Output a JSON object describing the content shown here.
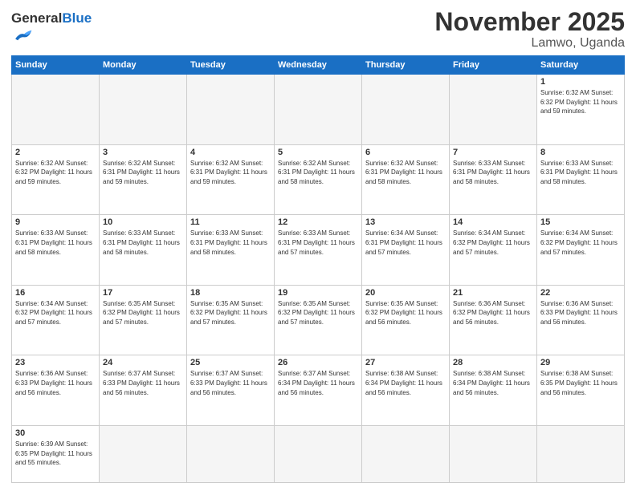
{
  "header": {
    "logo_general": "General",
    "logo_blue": "Blue",
    "month": "November 2025",
    "location": "Lamwo, Uganda"
  },
  "weekdays": [
    "Sunday",
    "Monday",
    "Tuesday",
    "Wednesday",
    "Thursday",
    "Friday",
    "Saturday"
  ],
  "weeks": [
    [
      {
        "day": "",
        "info": ""
      },
      {
        "day": "",
        "info": ""
      },
      {
        "day": "",
        "info": ""
      },
      {
        "day": "",
        "info": ""
      },
      {
        "day": "",
        "info": ""
      },
      {
        "day": "",
        "info": ""
      },
      {
        "day": "1",
        "info": "Sunrise: 6:32 AM\nSunset: 6:32 PM\nDaylight: 11 hours\nand 59 minutes."
      }
    ],
    [
      {
        "day": "2",
        "info": "Sunrise: 6:32 AM\nSunset: 6:32 PM\nDaylight: 11 hours\nand 59 minutes."
      },
      {
        "day": "3",
        "info": "Sunrise: 6:32 AM\nSunset: 6:31 PM\nDaylight: 11 hours\nand 59 minutes."
      },
      {
        "day": "4",
        "info": "Sunrise: 6:32 AM\nSunset: 6:31 PM\nDaylight: 11 hours\nand 59 minutes."
      },
      {
        "day": "5",
        "info": "Sunrise: 6:32 AM\nSunset: 6:31 PM\nDaylight: 11 hours\nand 58 minutes."
      },
      {
        "day": "6",
        "info": "Sunrise: 6:32 AM\nSunset: 6:31 PM\nDaylight: 11 hours\nand 58 minutes."
      },
      {
        "day": "7",
        "info": "Sunrise: 6:33 AM\nSunset: 6:31 PM\nDaylight: 11 hours\nand 58 minutes."
      },
      {
        "day": "8",
        "info": "Sunrise: 6:33 AM\nSunset: 6:31 PM\nDaylight: 11 hours\nand 58 minutes."
      }
    ],
    [
      {
        "day": "9",
        "info": "Sunrise: 6:33 AM\nSunset: 6:31 PM\nDaylight: 11 hours\nand 58 minutes."
      },
      {
        "day": "10",
        "info": "Sunrise: 6:33 AM\nSunset: 6:31 PM\nDaylight: 11 hours\nand 58 minutes."
      },
      {
        "day": "11",
        "info": "Sunrise: 6:33 AM\nSunset: 6:31 PM\nDaylight: 11 hours\nand 58 minutes."
      },
      {
        "day": "12",
        "info": "Sunrise: 6:33 AM\nSunset: 6:31 PM\nDaylight: 11 hours\nand 57 minutes."
      },
      {
        "day": "13",
        "info": "Sunrise: 6:34 AM\nSunset: 6:31 PM\nDaylight: 11 hours\nand 57 minutes."
      },
      {
        "day": "14",
        "info": "Sunrise: 6:34 AM\nSunset: 6:32 PM\nDaylight: 11 hours\nand 57 minutes."
      },
      {
        "day": "15",
        "info": "Sunrise: 6:34 AM\nSunset: 6:32 PM\nDaylight: 11 hours\nand 57 minutes."
      }
    ],
    [
      {
        "day": "16",
        "info": "Sunrise: 6:34 AM\nSunset: 6:32 PM\nDaylight: 11 hours\nand 57 minutes."
      },
      {
        "day": "17",
        "info": "Sunrise: 6:35 AM\nSunset: 6:32 PM\nDaylight: 11 hours\nand 57 minutes."
      },
      {
        "day": "18",
        "info": "Sunrise: 6:35 AM\nSunset: 6:32 PM\nDaylight: 11 hours\nand 57 minutes."
      },
      {
        "day": "19",
        "info": "Sunrise: 6:35 AM\nSunset: 6:32 PM\nDaylight: 11 hours\nand 57 minutes."
      },
      {
        "day": "20",
        "info": "Sunrise: 6:35 AM\nSunset: 6:32 PM\nDaylight: 11 hours\nand 56 minutes."
      },
      {
        "day": "21",
        "info": "Sunrise: 6:36 AM\nSunset: 6:32 PM\nDaylight: 11 hours\nand 56 minutes."
      },
      {
        "day": "22",
        "info": "Sunrise: 6:36 AM\nSunset: 6:33 PM\nDaylight: 11 hours\nand 56 minutes."
      }
    ],
    [
      {
        "day": "23",
        "info": "Sunrise: 6:36 AM\nSunset: 6:33 PM\nDaylight: 11 hours\nand 56 minutes."
      },
      {
        "day": "24",
        "info": "Sunrise: 6:37 AM\nSunset: 6:33 PM\nDaylight: 11 hours\nand 56 minutes."
      },
      {
        "day": "25",
        "info": "Sunrise: 6:37 AM\nSunset: 6:33 PM\nDaylight: 11 hours\nand 56 minutes."
      },
      {
        "day": "26",
        "info": "Sunrise: 6:37 AM\nSunset: 6:34 PM\nDaylight: 11 hours\nand 56 minutes."
      },
      {
        "day": "27",
        "info": "Sunrise: 6:38 AM\nSunset: 6:34 PM\nDaylight: 11 hours\nand 56 minutes."
      },
      {
        "day": "28",
        "info": "Sunrise: 6:38 AM\nSunset: 6:34 PM\nDaylight: 11 hours\nand 56 minutes."
      },
      {
        "day": "29",
        "info": "Sunrise: 6:38 AM\nSunset: 6:35 PM\nDaylight: 11 hours\nand 56 minutes."
      }
    ],
    [
      {
        "day": "30",
        "info": "Sunrise: 6:39 AM\nSunset: 6:35 PM\nDaylight: 11 hours\nand 55 minutes."
      },
      {
        "day": "",
        "info": ""
      },
      {
        "day": "",
        "info": ""
      },
      {
        "day": "",
        "info": ""
      },
      {
        "day": "",
        "info": ""
      },
      {
        "day": "",
        "info": ""
      },
      {
        "day": "",
        "info": ""
      }
    ]
  ]
}
